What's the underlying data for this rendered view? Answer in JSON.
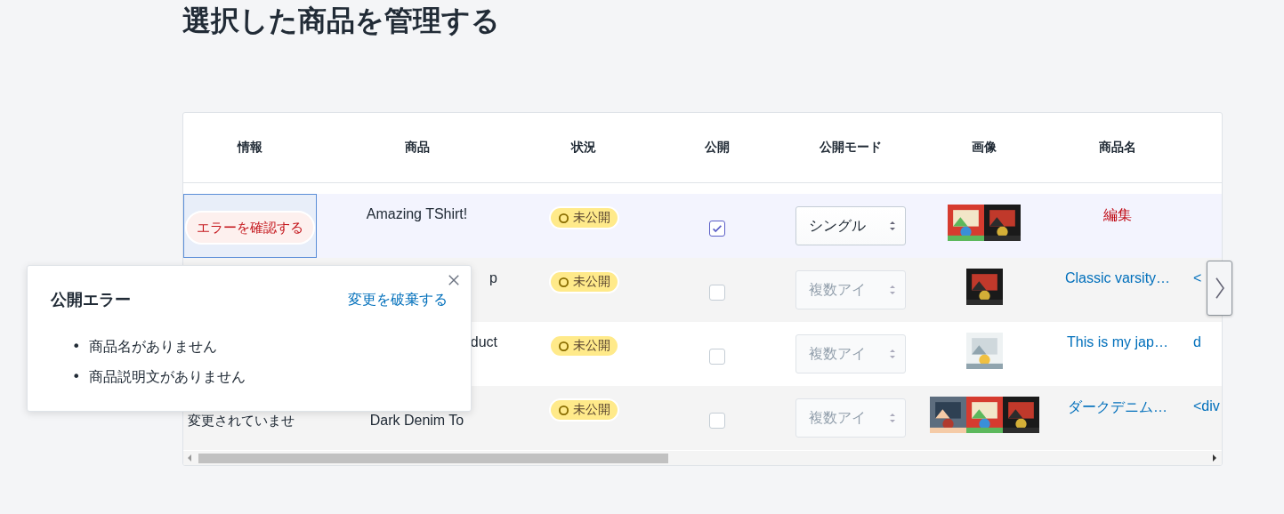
{
  "page_title": "選択した商品を管理する",
  "table": {
    "columns": [
      "情報",
      "商品",
      "状況",
      "公開",
      "公開モード",
      "画像",
      "商品名"
    ],
    "rows": [
      {
        "selected": true,
        "info": {
          "kind": "error_button",
          "text": "エラーを確認する"
        },
        "product": "Amazing TShirt!",
        "status": "未公開",
        "published": true,
        "mode": {
          "value": "シングル",
          "disabled": false
        },
        "name": {
          "kind": "edit",
          "text": "編集"
        },
        "column_8": ""
      },
      {
        "selected": false,
        "info": {
          "kind": "empty"
        },
        "product": "p",
        "status": "未公開",
        "published": false,
        "mode": {
          "value": "複数アイ",
          "disabled": true
        },
        "name": {
          "kind": "link",
          "text": "Classic varsity…"
        },
        "column_8": "<"
      },
      {
        "selected": false,
        "info": {
          "kind": "empty"
        },
        "product": "duct",
        "status": "未公開",
        "published": false,
        "mode": {
          "value": "複数アイ",
          "disabled": true
        },
        "name": {
          "kind": "link",
          "text": "This is my jap…"
        },
        "column_8": "d"
      },
      {
        "selected": false,
        "info": {
          "kind": "text",
          "text": "変更されていませ"
        },
        "product": "Dark Denim To",
        "status": "未公開",
        "published": false,
        "mode": {
          "value": "複数アイ",
          "disabled": true
        },
        "name": {
          "kind": "link",
          "text": "ダークデニム…"
        },
        "column_8": "<div"
      }
    ]
  },
  "popover": {
    "title": "公開エラー",
    "action": "変更を破棄する",
    "errors": [
      {
        "bullet": "•",
        "text": "商品名がありません"
      },
      {
        "bullet": "•",
        "text": "商品説明文がありません"
      }
    ]
  }
}
